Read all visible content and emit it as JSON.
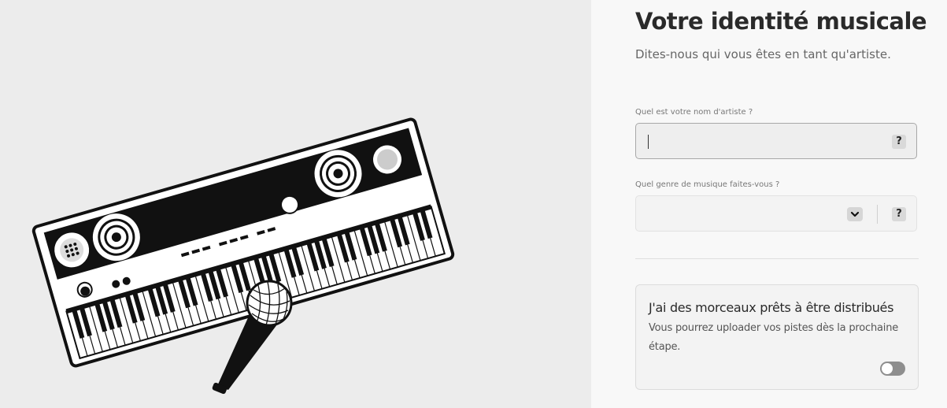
{
  "illustration": {
    "name": "keyboard-and-microphone-illustration"
  },
  "form": {
    "title": "Votre identité musicale",
    "subtitle": "Dites-nous qui vous êtes en tant qu'artiste.",
    "artist_name": {
      "label": "Quel est votre nom d'artiste ?",
      "value": "",
      "help": "?"
    },
    "genre": {
      "label": "Quel genre de musique faites-vous ?",
      "selected": "",
      "help": "?",
      "chevron_icon": "chevron-down-icon"
    },
    "distribution": {
      "title": "J'ai des morceaux prêts à être distribués",
      "description": "Vous pourrez uploader vos pistes dès la prochaine étape.",
      "toggle_on": false
    }
  },
  "colors": {
    "left_background": "#ececec",
    "right_background": "#f8f8f8",
    "title": "#2a2a2a",
    "toggle_off": "#8e8e8e"
  }
}
